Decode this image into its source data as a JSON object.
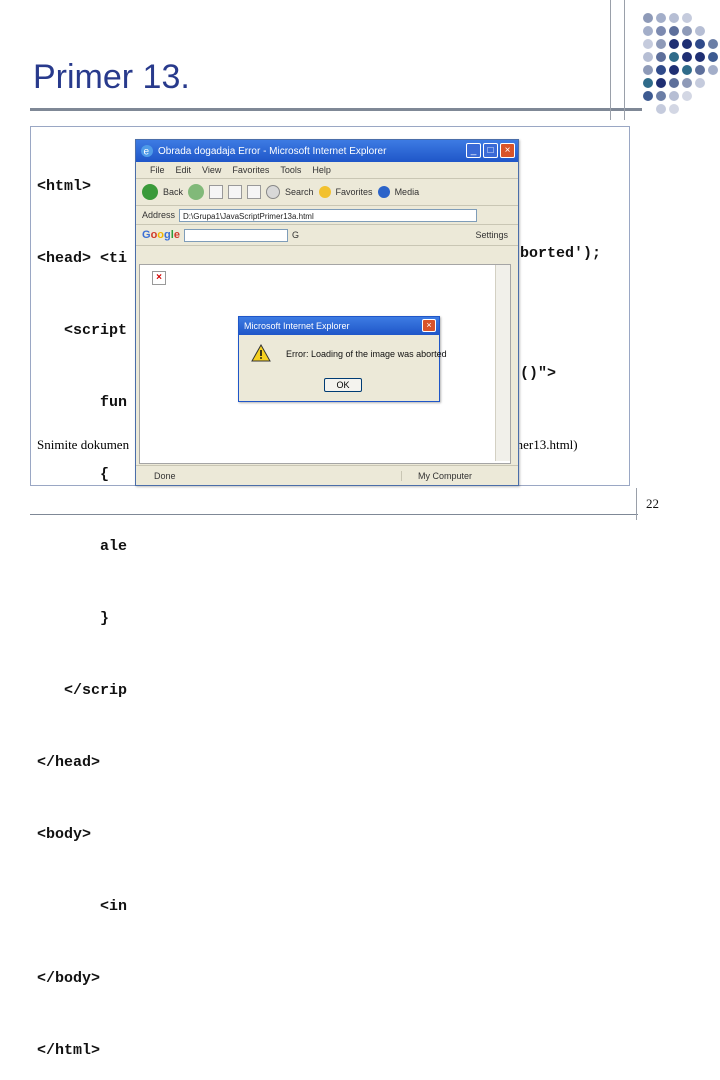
{
  "slide": {
    "title": "Primer 13.",
    "page_number": "22",
    "accent_color": "#283a8c"
  },
  "code": {
    "lines": [
      "<html>",
      "<head> <ti",
      "   <script",
      "       fun",
      "       {",
      "       ale",
      "       }",
      "   </scrip",
      "</head>",
      "<body>",
      "       <in",
      "</body>",
      "</html>"
    ],
    "right_fragments": {
      "alert_tail": "borted');",
      "img_tail": "()\">"
    },
    "caption_left": "Snimite dokumen",
    "caption_right": "mer13.html)"
  },
  "ie_window": {
    "title": "Obrada dogadaja Error - Microsoft Internet Explorer",
    "menu": [
      "File",
      "Edit",
      "View",
      "Favorites",
      "Tools",
      "Help"
    ],
    "toolbar": {
      "back": "Back",
      "search": "Search",
      "favorites": "Favorites",
      "media": "Media"
    },
    "address": {
      "label": "Address",
      "value": "D:\\Grupa1\\JavaScriptPrimer13a.html"
    },
    "google": {
      "logo": "Google",
      "go": "G",
      "settings": "Settings"
    },
    "status_left": "Done",
    "status_right": "My Computer"
  },
  "alert": {
    "title": "Microsoft Internet Explorer",
    "message": "Error: Loading of the image was aborted",
    "ok_label": "OK"
  }
}
